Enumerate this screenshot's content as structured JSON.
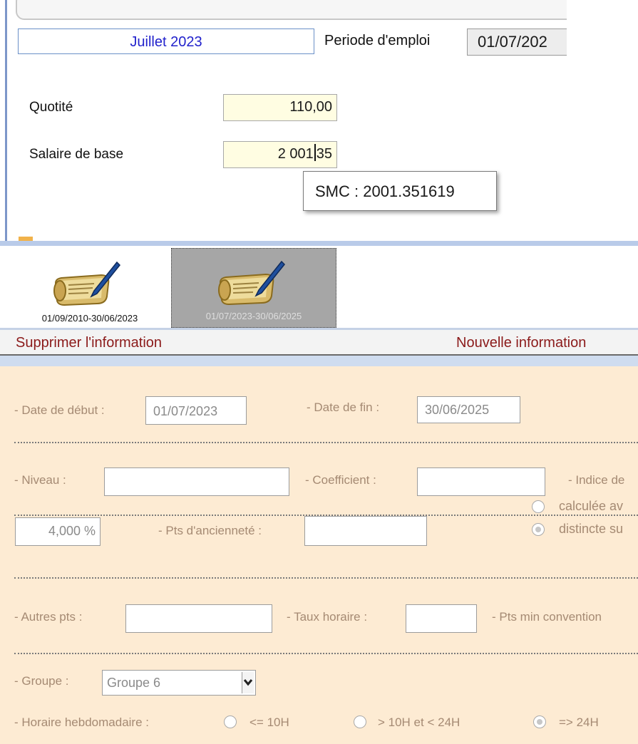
{
  "period": {
    "month_label": "Juillet 2023",
    "employment_label": "Periode d'emploi",
    "employment_value": "01/07/202"
  },
  "fields": {
    "quotite_label": "Quotité",
    "quotite_value": "110,00",
    "salaire_label": "Salaire de base",
    "salaire_value_a": "2 001",
    "salaire_value_b": "35",
    "tooltip": "SMC : 2001.351619"
  },
  "contract_tabs": [
    {
      "label": "01/09/2010-30/06/2023"
    },
    {
      "label": "01/07/2023-30/06/2025"
    }
  ],
  "actions": {
    "delete": "Supprimer l'information",
    "new": "Nouvelle information"
  },
  "form": {
    "date_debut_label": "- Date de début :",
    "date_debut_value": "01/07/2023",
    "date_fin_label": "- Date de fin :",
    "date_fin_value": "30/06/2025",
    "niveau_label": "- Niveau :",
    "niveau_value": "",
    "coefficient_label": "- Coefficient  :",
    "coefficient_value": "",
    "indice_label": "- Indice de",
    "pourcentage_value": "4,000 %",
    "pts_anciennete_label": "- Pts d'ancienneté :",
    "pts_anciennete_value": "",
    "radio_calculee": "calculée av",
    "radio_distincte": "distincte su",
    "autres_pts_label": "- Autres pts :",
    "autres_pts_value": "",
    "taux_horaire_label": "- Taux horaire :",
    "taux_horaire_value": "",
    "pts_min_label": "- Pts min convention",
    "groupe_label": "- Groupe :",
    "groupe_value": "Groupe 6",
    "horaire_label": "- Horaire hebdomadaire :",
    "horaire_opt1": "<= 10H",
    "horaire_opt2": "> 10H et < 24H",
    "horaire_opt3": "=> 24H",
    "horaire_selected": "=> 24H"
  },
  "icons": {
    "contract": "scroll-pen-icon",
    "dropdown": "chevron-down-icon"
  },
  "colors": {
    "month_text": "#2222cc",
    "action_text": "#8b1a1a",
    "form_bg": "#fdebd3",
    "field_bg": "#fffde2"
  }
}
